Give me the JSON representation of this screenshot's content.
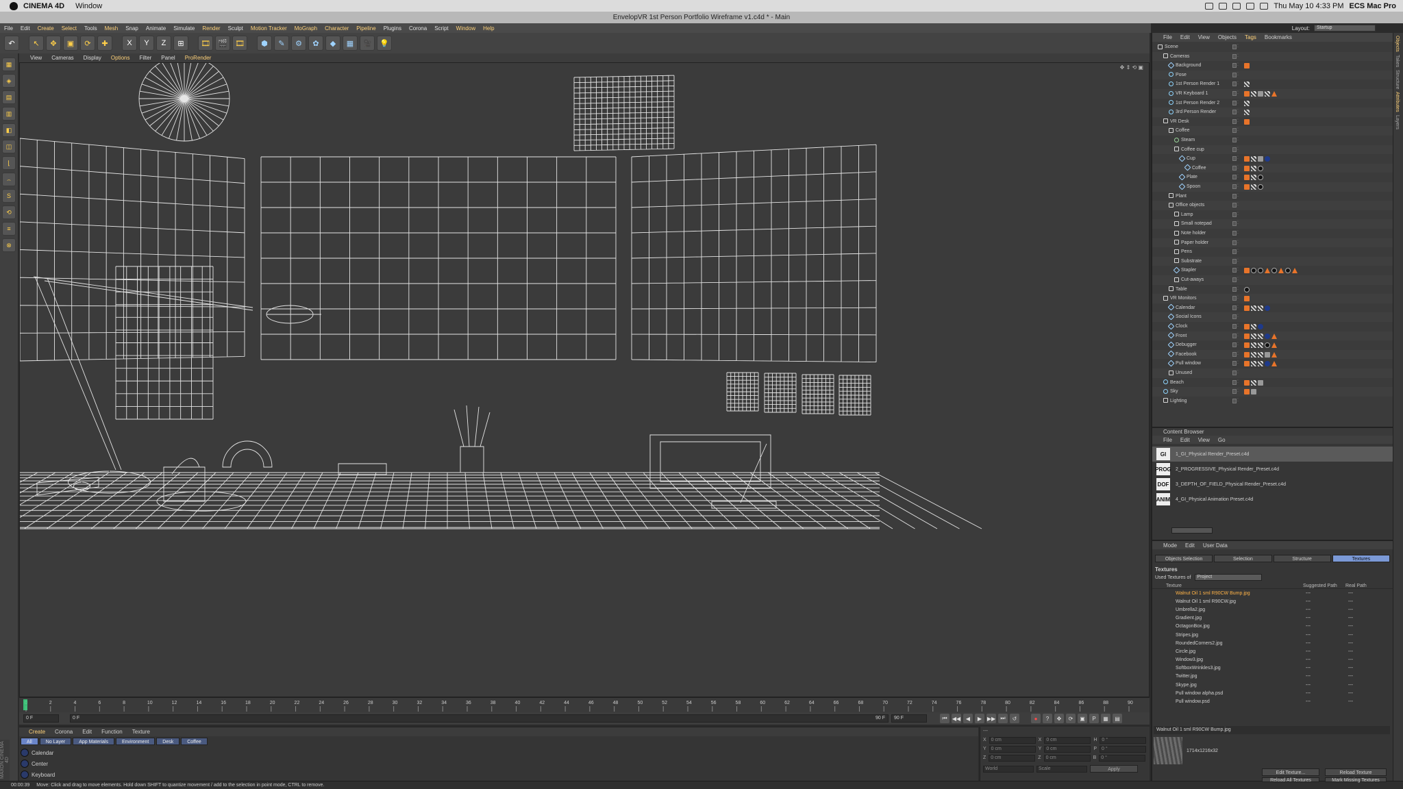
{
  "mac_menubar": {
    "app_name": "CINEMA 4D",
    "menus": [
      "Window"
    ],
    "status_icons": [
      "battery-icon",
      "dropbox-icon",
      "wifi-icon",
      "volume-icon",
      "time-machine-icon"
    ],
    "clock": "Thu May 10  4:33 PM",
    "computer_name": "ECS Mac Pro"
  },
  "window_title": "EnvelopVR 1st Person Portfolio Wireframe v1.c4d * - Main",
  "main_menu": [
    "File",
    "Edit",
    "Create",
    "Select",
    "Tools",
    "Mesh",
    "Snap",
    "Animate",
    "Simulate",
    "Render",
    "Sculpt",
    "Motion Tracker",
    "MoGraph",
    "Character",
    "Pipeline",
    "Plugins",
    "Corona",
    "Script",
    "Window",
    "Help"
  ],
  "main_menu_highlight": [
    "Create",
    "Select",
    "Mesh",
    "Render",
    "Motion Tracker",
    "MoGraph",
    "Character",
    "Pipeline",
    "Window",
    "Help"
  ],
  "layout": {
    "label": "Layout:",
    "value": "Startup"
  },
  "toolbar": {
    "undo": "↶",
    "tools": [
      "↖",
      "✥",
      "▣",
      "⟳",
      "✚"
    ],
    "axes": [
      "X",
      "Y",
      "Z",
      "⊞"
    ],
    "render": [
      "🎞",
      "🎬",
      "🎞"
    ],
    "objects": [
      "⬢",
      "✎",
      "⚙",
      "✿",
      "◆",
      "▦",
      "🎥",
      "💡"
    ]
  },
  "left_tools": [
    "▦",
    "◈",
    "▤",
    "▥",
    "◧",
    "◫",
    "⌊",
    "⌢",
    "S",
    "⟲",
    "≡",
    "⊗"
  ],
  "viewport_menu": [
    "View",
    "Cameras",
    "Display",
    "Options",
    "Filter",
    "Panel",
    "ProRender"
  ],
  "viewport_menu_highlight": [
    "Options",
    "ProRender"
  ],
  "viewport_corner": "✥ ⇕ ⟲ ▣",
  "timeline": {
    "ticks": [
      "0",
      "2",
      "4",
      "6",
      "8",
      "10",
      "12",
      "14",
      "16",
      "18",
      "20",
      "22",
      "24",
      "26",
      "28",
      "30",
      "32",
      "34",
      "36",
      "38",
      "40",
      "42",
      "44",
      "46",
      "48",
      "50",
      "52",
      "54",
      "56",
      "58",
      "60",
      "62",
      "64",
      "66",
      "68",
      "70",
      "72",
      "74",
      "76",
      "78",
      "80",
      "82",
      "84",
      "86",
      "88",
      "90"
    ],
    "current_frame": "0 F",
    "start_frame": "0 F",
    "range_start": "0 F",
    "range_end": "90 F",
    "end_frame": "90 F",
    "frame_label": "0 F",
    "controls": [
      "⏮",
      "◀◀",
      "◀",
      "▶",
      "▶▶",
      "⏭",
      "↺"
    ],
    "record": [
      "●",
      "?",
      "✥",
      "⟳",
      "▣",
      "P",
      "▦",
      "▤"
    ]
  },
  "material_manager": {
    "menu": [
      "Create",
      "Corona",
      "Edit",
      "Function",
      "Texture"
    ],
    "tabs": [
      "All",
      "No Layer",
      "App Materials",
      "Environment",
      "Desk",
      "Coffee"
    ],
    "materials": [
      "Calendar",
      "Center",
      "Keyboard"
    ]
  },
  "coordinates": {
    "header": "---",
    "rows": [
      {
        "a": "X",
        "v1": "0 cm",
        "b": "X",
        "v2": "0 cm",
        "c": "H",
        "v3": "0 °"
      },
      {
        "a": "Y",
        "v1": "0 cm",
        "b": "Y",
        "v2": "0 cm",
        "c": "P",
        "v3": "0 °"
      },
      {
        "a": "Z",
        "v1": "0 cm",
        "b": "Z",
        "v2": "0 cm",
        "c": "B",
        "v3": "0 °"
      }
    ],
    "mode": "World",
    "scale": "Scale",
    "apply": "Apply"
  },
  "status_bar": {
    "time": "00:00:39",
    "message": "Move: Click and drag to move elements. Hold down SHIFT to quantize movement / add to the selection in point mode, CTRL to remove."
  },
  "maxon_logo": "MAXON CINEMA 4D",
  "object_manager": {
    "menu": [
      "File",
      "Edit",
      "View",
      "Objects",
      "Tags",
      "Bookmarks"
    ],
    "menu_highlight": "Tags",
    "objects": [
      {
        "name": "Scene",
        "lvl": 0,
        "icon": "L",
        "tags": []
      },
      {
        "name": "Cameras",
        "lvl": 1,
        "icon": "L",
        "tags": []
      },
      {
        "name": "Background",
        "lvl": 2,
        "icon": "M",
        "tags": [
          "o"
        ]
      },
      {
        "name": "Pose",
        "lvl": 2,
        "icon": "C",
        "tags": []
      },
      {
        "name": "1st Person Render 1",
        "lvl": 2,
        "icon": "C",
        "tags": [
          "c"
        ]
      },
      {
        "name": "VR Keyboard 1",
        "lvl": 2,
        "icon": "C",
        "tags": [
          "o",
          "c",
          "g",
          "c",
          "tri"
        ]
      },
      {
        "name": "1st Person Render 2",
        "lvl": 2,
        "icon": "C",
        "tags": [
          "c"
        ]
      },
      {
        "name": "3rd Person Render",
        "lvl": 2,
        "icon": "C",
        "tags": [
          "c"
        ]
      },
      {
        "name": "VR Desk",
        "lvl": 1,
        "icon": "L",
        "tags": [
          "o"
        ]
      },
      {
        "name": "Coffee",
        "lvl": 2,
        "icon": "L",
        "tags": []
      },
      {
        "name": "Steam",
        "lvl": 3,
        "icon": "J",
        "tags": []
      },
      {
        "name": "Coffee cup",
        "lvl": 3,
        "icon": "L",
        "tags": []
      },
      {
        "name": "Cup",
        "lvl": 4,
        "icon": "M",
        "tags": [
          "o",
          "c",
          "g",
          "b"
        ]
      },
      {
        "name": "Coffee",
        "lvl": 5,
        "icon": "M",
        "tags": [
          "o",
          "c",
          "s"
        ]
      },
      {
        "name": "Plate",
        "lvl": 4,
        "icon": "M",
        "tags": [
          "o",
          "c",
          "s"
        ]
      },
      {
        "name": "Spoon",
        "lvl": 4,
        "icon": "M",
        "tags": [
          "o",
          "c",
          "s"
        ]
      },
      {
        "name": "Plant",
        "lvl": 2,
        "icon": "L",
        "tags": []
      },
      {
        "name": "Office objects",
        "lvl": 2,
        "icon": "L",
        "tags": []
      },
      {
        "name": "Lamp",
        "lvl": 3,
        "icon": "L",
        "tags": []
      },
      {
        "name": "Small notepad",
        "lvl": 3,
        "icon": "L",
        "tags": []
      },
      {
        "name": "Note holder",
        "lvl": 3,
        "icon": "L",
        "tags": []
      },
      {
        "name": "Paper holder",
        "lvl": 3,
        "icon": "L",
        "tags": []
      },
      {
        "name": "Pens",
        "lvl": 3,
        "icon": "L",
        "tags": []
      },
      {
        "name": "Substrate",
        "lvl": 3,
        "icon": "L",
        "tags": []
      },
      {
        "name": "Stapler",
        "lvl": 3,
        "icon": "M",
        "tags": [
          "o",
          "s",
          "s",
          "tri",
          "s",
          "tri",
          "s",
          "tri"
        ]
      },
      {
        "name": "Cut-aways",
        "lvl": 3,
        "icon": "L",
        "tags": []
      },
      {
        "name": "Table",
        "lvl": 2,
        "icon": "L",
        "tags": [
          "s"
        ]
      },
      {
        "name": "VR Monitors",
        "lvl": 1,
        "icon": "L",
        "tags": [
          "o"
        ]
      },
      {
        "name": "Calendar",
        "lvl": 2,
        "icon": "M",
        "tags": [
          "o",
          "c",
          "c",
          "b"
        ]
      },
      {
        "name": "Social Icons",
        "lvl": 2,
        "icon": "M",
        "tags": []
      },
      {
        "name": "Clock",
        "lvl": 2,
        "icon": "M",
        "tags": [
          "o",
          "c",
          "b"
        ]
      },
      {
        "name": "Front",
        "lvl": 2,
        "icon": "M",
        "tags": [
          "o",
          "c",
          "c",
          "b",
          "tri"
        ]
      },
      {
        "name": "Debugger",
        "lvl": 2,
        "icon": "M",
        "tags": [
          "o",
          "c",
          "c",
          "s",
          "tri"
        ]
      },
      {
        "name": "Facebook",
        "lvl": 2,
        "icon": "M",
        "tags": [
          "o",
          "c",
          "c",
          "g",
          "tri"
        ]
      },
      {
        "name": "Pull window",
        "lvl": 2,
        "icon": "M",
        "tags": [
          "o",
          "c",
          "c",
          "b",
          "tri"
        ]
      },
      {
        "name": "Unused",
        "lvl": 2,
        "icon": "L",
        "tags": []
      },
      {
        "name": "Beach",
        "lvl": 1,
        "icon": "C",
        "tags": [
          "o",
          "c",
          "g"
        ]
      },
      {
        "name": "Sky",
        "lvl": 1,
        "icon": "C",
        "tags": [
          "o",
          "g"
        ]
      },
      {
        "name": "Lighting",
        "lvl": 1,
        "icon": "L",
        "tags": []
      }
    ]
  },
  "content_browser": {
    "title": "Content Browser",
    "menu": [
      "File",
      "Edit",
      "View",
      "Go"
    ],
    "items": [
      {
        "icon": "GI",
        "name": "1_GI_Physical Render_Preset.c4d",
        "selected": true
      },
      {
        "icon": "PROG",
        "name": "2_PROGRESSIVE_Physical Render_Preset.c4d",
        "selected": false
      },
      {
        "icon": "DOF",
        "name": "3_DEPTH_OF_FIELD_Physical Render_Preset.c4d",
        "selected": false
      },
      {
        "icon": "ANIM",
        "name": "4_GI_Physical Animation Preset.c4d",
        "selected": false
      }
    ]
  },
  "attribute_manager": {
    "menu": [
      "Mode",
      "Edit",
      "User Data"
    ],
    "tabs": [
      "Objects Selection",
      "Selection",
      "Structure",
      "Textures"
    ],
    "active_tab": "Textures",
    "section": "Textures",
    "used_label": "Used Textures of",
    "used_value": "Project",
    "columns": [
      "Texture",
      "Suggested Path",
      "Real Path"
    ],
    "textures": [
      {
        "name": "Walnut Oil 1 sml R90CW Bump.jpg",
        "sug": "---",
        "real": "---",
        "hl": true
      },
      {
        "name": "Walnut Oil 1 sml R90CW.jpg",
        "sug": "---",
        "real": "---",
        "hl": false
      },
      {
        "name": "Umbrella2.jpg",
        "sug": "---",
        "real": "---",
        "hl": false
      },
      {
        "name": "Gradient.jpg",
        "sug": "---",
        "real": "---",
        "hl": false
      },
      {
        "name": "OctagonBox.jpg",
        "sug": "---",
        "real": "---",
        "hl": false
      },
      {
        "name": "Stripes.jpg",
        "sug": "---",
        "real": "---",
        "hl": false
      },
      {
        "name": "RoundedCorners2.jpg",
        "sug": "---",
        "real": "---",
        "hl": false
      },
      {
        "name": "Circle.jpg",
        "sug": "---",
        "real": "---",
        "hl": false
      },
      {
        "name": "Window3.jpg",
        "sug": "---",
        "real": "---",
        "hl": false
      },
      {
        "name": "SoftboxWrinkles3.jpg",
        "sug": "---",
        "real": "---",
        "hl": false
      },
      {
        "name": "Twitter.jpg",
        "sug": "---",
        "real": "---",
        "hl": false
      },
      {
        "name": "Skype.jpg",
        "sug": "---",
        "real": "---",
        "hl": false
      },
      {
        "name": "Pull window alpha.psd",
        "sug": "---",
        "real": "---",
        "hl": false
      },
      {
        "name": "Pull window.psd",
        "sug": "---",
        "real": "---",
        "hl": false
      }
    ],
    "preview_name": "Walnut Oil 1 sml R90CW Bump.jpg",
    "preview_size": "1714x1216x32",
    "buttons": [
      "Edit Texture...",
      "Reload Texture",
      "Reload All Textures",
      "Mark Missing Textures"
    ]
  },
  "side_tabs": [
    "Objects",
    "Takes",
    "Structure",
    "Attributes",
    "Layers"
  ],
  "colors": {
    "accent": "#ffd27a",
    "selection": "#7b99d6",
    "tag_orange": "#e8742a",
    "wire": "#e6e6e6",
    "viewport_bg": "#3b3b3b"
  }
}
